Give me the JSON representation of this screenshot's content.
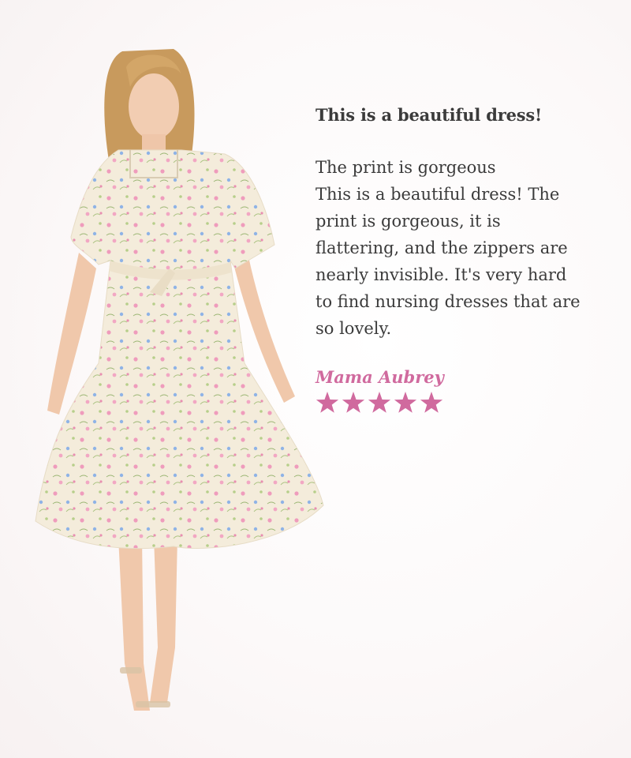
{
  "review": {
    "title": "This is a beautiful dress!",
    "subheading": "The print is gorgeous",
    "body": "This is a beautiful dress! The print is gorgeous, it is flattering, and the zippers are nearly invisible. It's very hard to find nursing dresses that are so lovely.",
    "reviewer": "Mama Aubrey",
    "rating": 5,
    "rating_max": 5,
    "star_icon": "star-icon"
  },
  "colors": {
    "accent": "#d06a9e",
    "text": "#3b3b3b",
    "background": "#fcf9f9",
    "dress": "#f3ecdc"
  }
}
